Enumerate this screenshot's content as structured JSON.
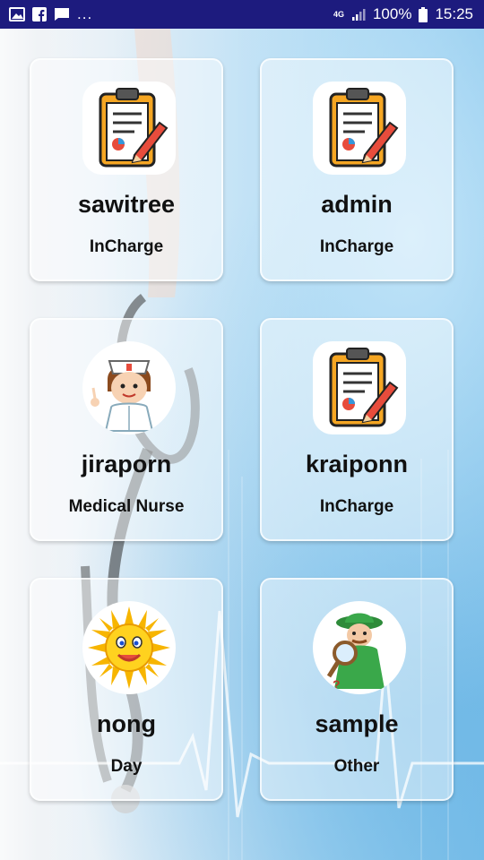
{
  "status_bar": {
    "left_icons": [
      "image-icon",
      "facebook-icon",
      "message-icon"
    ],
    "overflow": "...",
    "network": "4G",
    "battery": "100%",
    "time": "15:25"
  },
  "users": [
    {
      "name": "sawitree",
      "role": "InCharge",
      "icon": "clipboard-chart-icon"
    },
    {
      "name": "admin",
      "role": "InCharge",
      "icon": "clipboard-chart-icon"
    },
    {
      "name": "jiraporn",
      "role": "Medical Nurse",
      "icon": "nurse-icon"
    },
    {
      "name": "kraiponn",
      "role": "InCharge",
      "icon": "clipboard-chart-icon"
    },
    {
      "name": "nong",
      "role": "Day",
      "icon": "sun-icon"
    },
    {
      "name": "sample",
      "role": "Other",
      "icon": "detective-icon"
    }
  ]
}
